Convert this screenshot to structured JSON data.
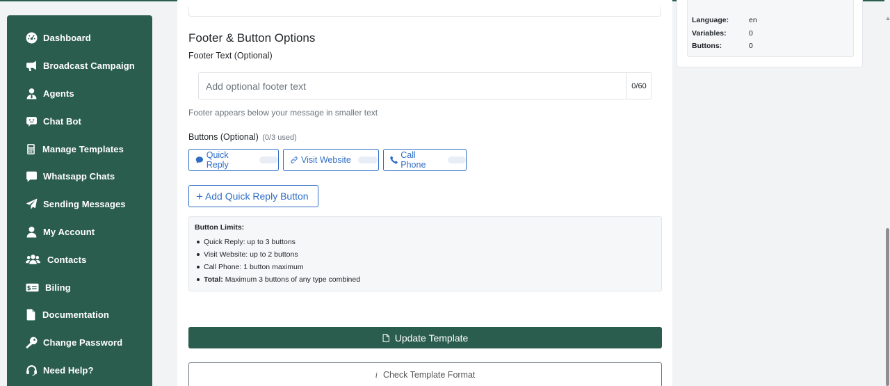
{
  "sidebar": {
    "items": [
      {
        "label": "Dashboard",
        "icon": "dashboard-icon"
      },
      {
        "label": "Broadcast Campaign",
        "icon": "megaphone-icon"
      },
      {
        "label": "Agents",
        "icon": "agent-icon"
      },
      {
        "label": "Chat Bot",
        "icon": "chatbot-icon"
      },
      {
        "label": "Manage Templates",
        "icon": "calculator-icon"
      },
      {
        "label": "Whatsapp Chats",
        "icon": "chat-icon"
      },
      {
        "label": "Sending Messages",
        "icon": "paper-plane-icon"
      },
      {
        "label": "My Account",
        "icon": "user-icon"
      },
      {
        "label": "Contacts",
        "icon": "users-icon"
      },
      {
        "label": "Biling",
        "icon": "money-bill-icon"
      },
      {
        "label": "Documentation",
        "icon": "file-icon"
      },
      {
        "label": "Change Password",
        "icon": "key-icon"
      },
      {
        "label": "Need Help?",
        "icon": "headset-icon"
      }
    ]
  },
  "footer_section": {
    "title": "Footer & Button Options",
    "footer_label": "Footer Text (Optional)",
    "footer_placeholder": "Add optional footer text",
    "footer_value": "",
    "footer_counter": "0/60",
    "footer_help": "Footer appears below your message in smaller text"
  },
  "buttons_section": {
    "label": "Buttons (Optional)",
    "used": "(0/3 used)",
    "types": [
      {
        "label": "Quick Reply",
        "icon": "comment-icon"
      },
      {
        "label": "Visit Website",
        "icon": "link-icon"
      },
      {
        "label": "Call Phone",
        "icon": "phone-icon"
      }
    ],
    "add_button": "Add Quick Reply Button"
  },
  "limits": {
    "title": "Button Limits:",
    "items": [
      {
        "bold": "",
        "text": "Quick Reply: up to 3 buttons"
      },
      {
        "bold": "",
        "text": "Visit Website: up to 2 buttons"
      },
      {
        "bold": "",
        "text": "Call Phone: 1 button maximum"
      },
      {
        "bold": "Total:",
        "text": " Maximum 3 buttons of any type combined"
      }
    ]
  },
  "actions": {
    "update": "Update Template",
    "check": "Check Template Format"
  },
  "summary": {
    "rows": [
      {
        "key": "Language:",
        "value": "en"
      },
      {
        "key": "Variables:",
        "value": "0"
      },
      {
        "key": "Buttons:",
        "value": "0"
      }
    ]
  },
  "colors": {
    "brand": "#2b5d4f",
    "link": "#2f6dc5"
  }
}
